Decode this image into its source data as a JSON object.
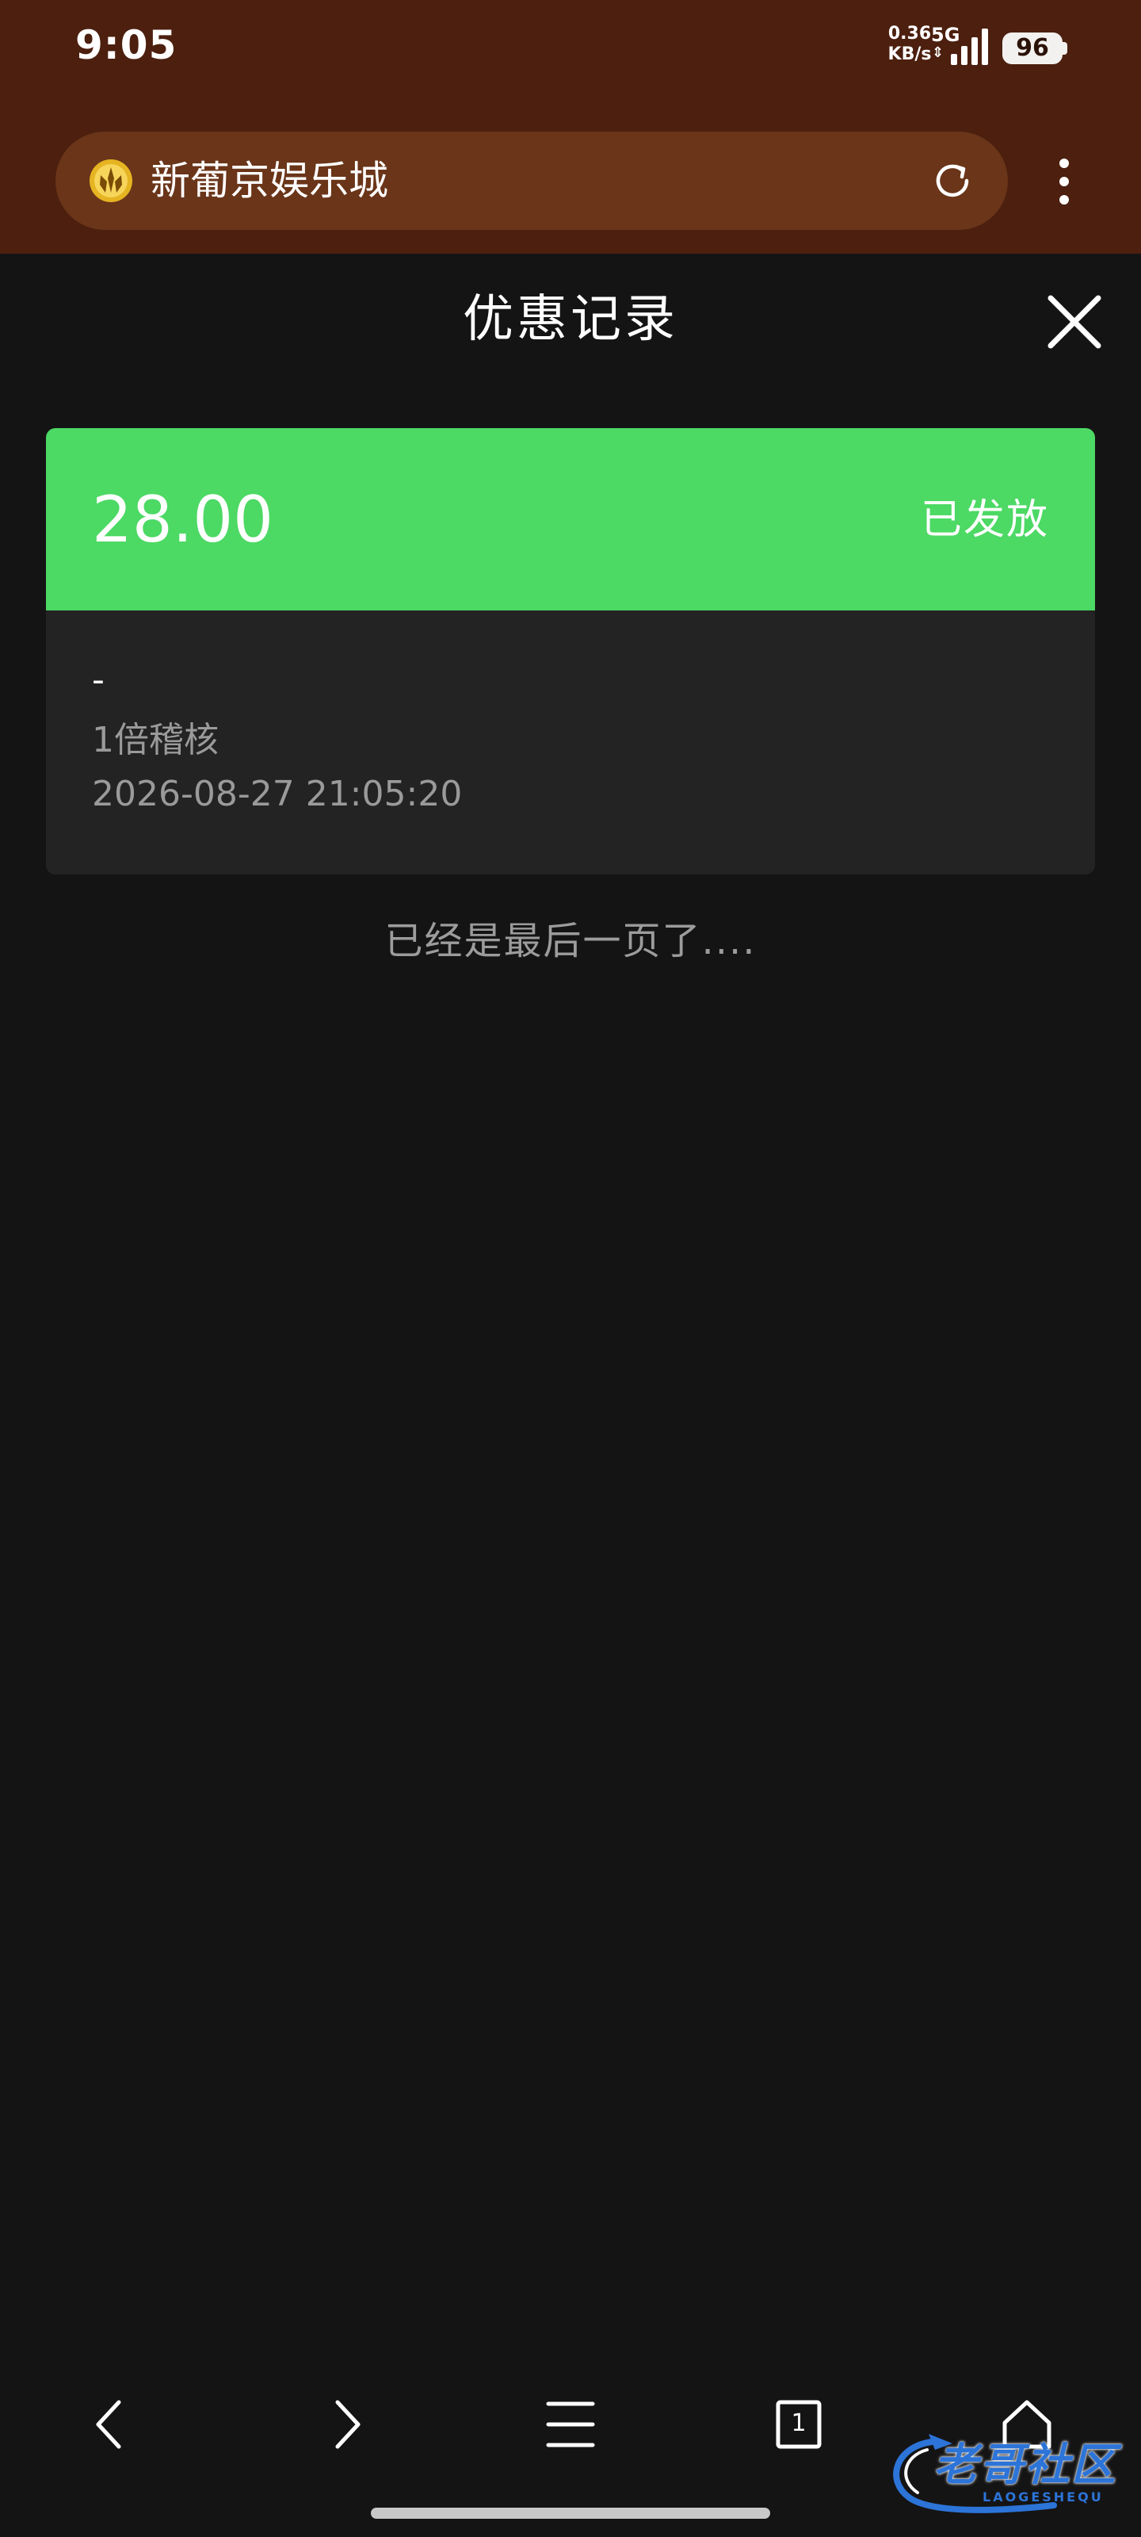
{
  "status_bar": {
    "time": "9:05",
    "net_speed_value": "0.36",
    "net_speed_unit": "KB/s",
    "network_type": "5G",
    "battery": "96"
  },
  "browser": {
    "site_title": "新葡京娱乐城"
  },
  "page": {
    "title": "优惠记录"
  },
  "records": [
    {
      "amount": "28.00",
      "status": "已发放",
      "name": "-",
      "audit": "1倍稽核",
      "time": "2026-08-27 21:05:20"
    }
  ],
  "end_message": "已经是最后一页了....",
  "bottom_nav": {
    "tabs_count": "1"
  },
  "watermark": {
    "text": "老哥社区",
    "subtext": "LAOGESHEQU"
  },
  "colors": {
    "chrome_bg": "#4c1f0e",
    "address_bar_bg": "#6a3519",
    "page_bg": "#151415",
    "card_bg": "#232323",
    "card_header_bg": "#4cd964",
    "secondary_text": "#9a9a9a"
  }
}
